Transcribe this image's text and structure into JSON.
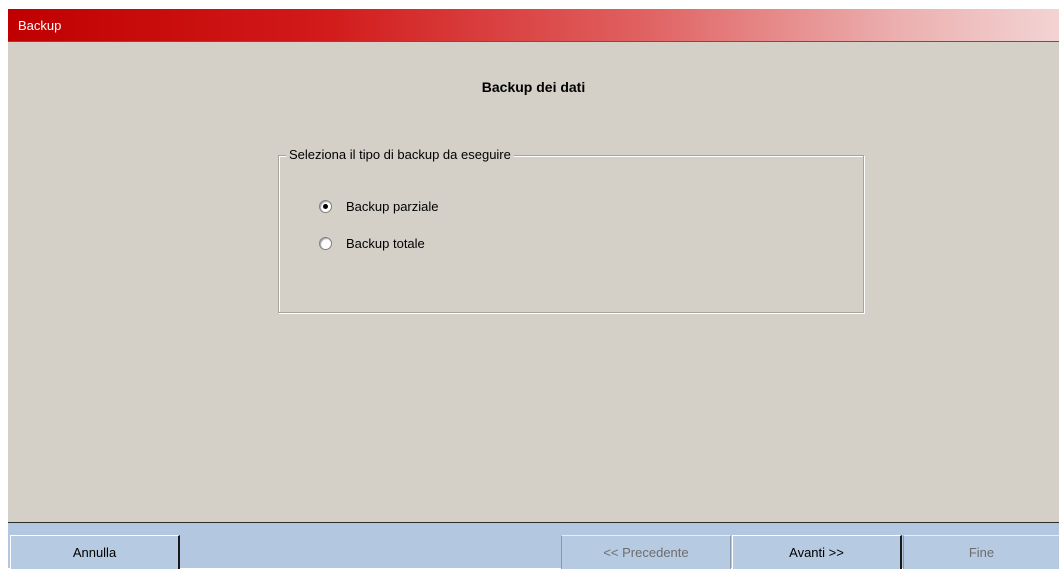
{
  "window": {
    "title": "Backup"
  },
  "main": {
    "heading": "Backup dei dati",
    "group": {
      "legend": "Seleziona il tipo di backup da eseguire",
      "options": [
        {
          "label": "Backup parziale",
          "selected": true
        },
        {
          "label": "Backup totale",
          "selected": false
        }
      ]
    }
  },
  "footer": {
    "cancel_label": "Annulla",
    "previous_label": "<< Precedente",
    "next_label": "Avanti >>",
    "finish_label": "Fine",
    "previous_enabled": false,
    "next_enabled": true,
    "finish_enabled": false
  },
  "colors": {
    "titlebar_start": "#c00000",
    "window_background": "#d4d0c8",
    "footer_background": "#b3c8e0",
    "disabled_text": "#6d6d6d"
  }
}
